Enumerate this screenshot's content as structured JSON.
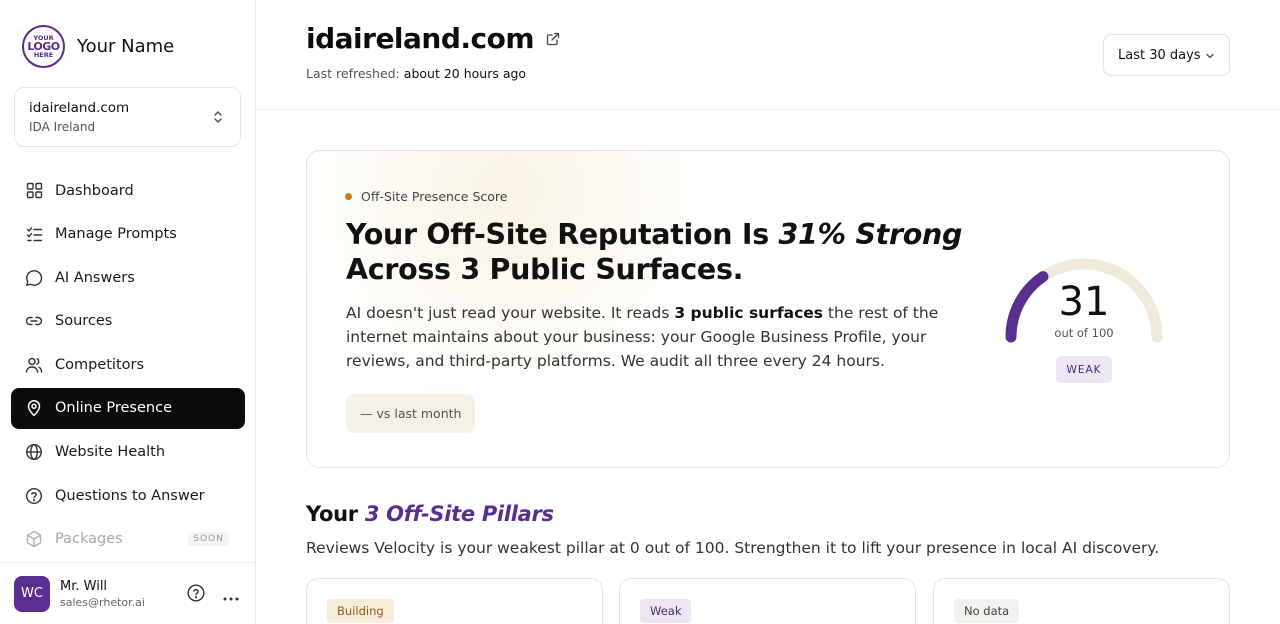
{
  "brand": {
    "logo_line1": "YOUR",
    "logo_line2": "LOGO",
    "logo_line3": "HERE",
    "name": "Your Name"
  },
  "site": {
    "domain": "idaireland.com",
    "org": "IDA Ireland"
  },
  "nav": {
    "items": [
      {
        "label": "Dashboard",
        "icon": "grid-icon"
      },
      {
        "label": "Manage Prompts",
        "icon": "checklist-icon"
      },
      {
        "label": "AI Answers",
        "icon": "chat-bubble-icon"
      },
      {
        "label": "Sources",
        "icon": "link-icon"
      },
      {
        "label": "Competitors",
        "icon": "users-icon"
      },
      {
        "label": "Online Presence",
        "icon": "map-pin-icon",
        "active": true
      },
      {
        "label": "Website Health",
        "icon": "globe-icon"
      },
      {
        "label": "Questions to Answer",
        "icon": "help-circle-icon"
      },
      {
        "label": "Packages",
        "icon": "package-icon",
        "badge": "SOON",
        "disabled": true
      }
    ]
  },
  "user": {
    "initials": "WC",
    "name": "Mr. Will",
    "email": "sales@rhetor.ai"
  },
  "header": {
    "title": "idaireland.com",
    "refreshed_label": "Last refreshed:",
    "refreshed_value": "about 20 hours ago",
    "date_range": "Last 30 days"
  },
  "score_card": {
    "label": "Off-Site Presence Score",
    "headline_pre": "Your Off-Site Reputation Is ",
    "headline_em": "31% Strong",
    "headline_post": " Across 3 Public Surfaces.",
    "desc_pre": "AI doesn't just read your website. It reads ",
    "desc_bold": "3 public surfaces",
    "desc_post": " the rest of the internet maintains about your business: your Google Business Profile, your reviews, and third-party platforms. We audit all three every 24 hours.",
    "trend": "— vs last month",
    "score": 31,
    "score_max": 100,
    "score_text": "31",
    "score_sub": "out of 100",
    "rating": "WEAK",
    "colors": {
      "arc_fill": "#5a2d91",
      "arc_track": "#efeadc",
      "accent_dot": "#c47a1a"
    }
  },
  "pillars": {
    "title_pre": "Your ",
    "title_em": "3 Off-Site Pillars",
    "subtitle": "Reviews Velocity is your weakest pillar at 0 out of 100. Strengthen it to lift your presence in local AI discovery.",
    "cards": [
      {
        "status": "Building",
        "bg": "#f8ecdb",
        "color": "#9a5a14"
      },
      {
        "status": "Weak",
        "bg": "#ece7f3",
        "color": "#4a2a74"
      },
      {
        "status": "No data",
        "bg": "#f1f1ee",
        "color": "#444444"
      }
    ]
  }
}
